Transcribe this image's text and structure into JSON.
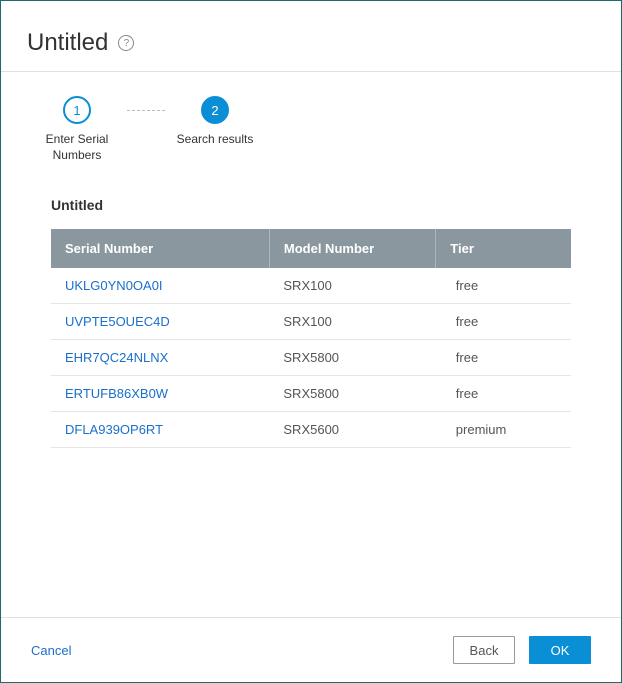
{
  "title": "Untitled",
  "help_icon_glyph": "?",
  "stepper": {
    "steps": [
      {
        "num": "1",
        "label": "Enter Serial\nNumbers"
      },
      {
        "num": "2",
        "label": "Search results"
      }
    ]
  },
  "subtitle": "Untitled",
  "table": {
    "headers": {
      "serial": "Serial Number",
      "model": "Model Number",
      "tier": "Tier"
    },
    "rows": [
      {
        "serial": "UKLG0YN0OA0I",
        "model": "SRX100",
        "tier": "free"
      },
      {
        "serial": "UVPTE5OUEC4D",
        "model": "SRX100",
        "tier": "free"
      },
      {
        "serial": "EHR7QC24NLNX",
        "model": "SRX5800",
        "tier": "free"
      },
      {
        "serial": "ERTUFB86XB0W",
        "model": "SRX5800",
        "tier": "free"
      },
      {
        "serial": "DFLA939OP6RT",
        "model": "SRX5600",
        "tier": "premium"
      }
    ]
  },
  "footer": {
    "cancel": "Cancel",
    "back": "Back",
    "ok": "OK"
  }
}
